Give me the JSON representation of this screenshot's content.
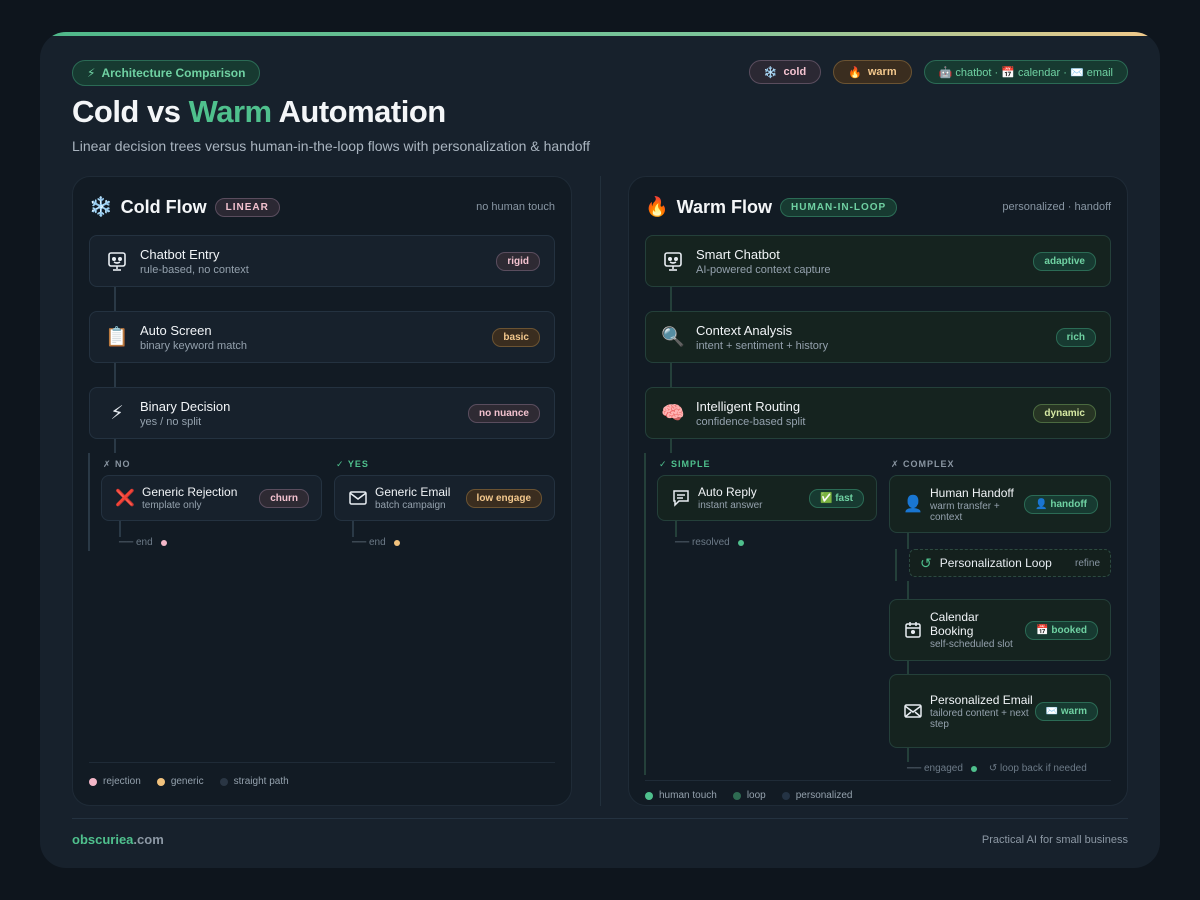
{
  "header": {
    "badge_icon": "⚡",
    "badge_label": "Architecture Comparison",
    "chips": {
      "cold_icon": "❄️",
      "cold": "cold",
      "warm_icon": "🔥",
      "warm": "warm",
      "tools": "🤖 chatbot · 📅 calendar · ✉️ email"
    },
    "title_pre": "Cold vs ",
    "title_accent": "Warm",
    "title_post": " Automation",
    "subtitle": "Linear decision trees versus human-in-the-loop flows with personalization & handoff"
  },
  "cold": {
    "emoji": "❄️",
    "title": "Cold Flow",
    "tag": "LINEAR",
    "note": "no human touch",
    "nodes": [
      {
        "title": "Chatbot Entry",
        "sub": "rule-based, no context",
        "badge": "rigid"
      },
      {
        "title": "Auto Screen",
        "sub": "binary keyword match",
        "badge": "basic",
        "icon": "📋"
      },
      {
        "title": "Binary Decision",
        "sub": "yes / no split",
        "badge": "no nuance",
        "icon": "⚡"
      }
    ],
    "branch_no": "✗ NO",
    "branch_yes": "✓ YES",
    "no_node": {
      "title": "Generic Rejection",
      "sub": "template only",
      "badge": "churn",
      "icon": "❌"
    },
    "yes_node": {
      "title": "Generic Email",
      "sub": "batch campaign",
      "badge": "low engage"
    },
    "end_no": "── end",
    "end_yes": "── end",
    "legend": [
      "rejection",
      "generic",
      "straight path"
    ]
  },
  "warm": {
    "emoji": "🔥",
    "title": "Warm Flow",
    "tag": "HUMAN-IN-LOOP",
    "note": "personalized · handoff",
    "nodes": [
      {
        "title": "Smart Chatbot",
        "sub": "AI-powered context capture",
        "badge": "adaptive"
      },
      {
        "title": "Context Analysis",
        "sub": "intent + sentiment + history",
        "badge": "rich",
        "icon": "🔍"
      },
      {
        "title": "Intelligent Routing",
        "sub": "confidence-based split",
        "badge": "dynamic",
        "icon": "🧠"
      }
    ],
    "branch_simple": "✓ SIMPLE",
    "branch_complex": "✗ COMPLEX",
    "simple_node": {
      "title": "Auto Reply",
      "sub": "instant answer",
      "badge": "✅ fast"
    },
    "simple_end": "── resolved",
    "handoff": {
      "title": "Human Handoff",
      "sub": "warm transfer + context",
      "badge": "👤 handoff",
      "icon": "👤"
    },
    "loop": {
      "title": "Personalization Loop",
      "tag": "refine",
      "icon": "↺"
    },
    "calendar": {
      "title": "Calendar Booking",
      "sub": "self-scheduled slot",
      "badge": "📅 booked"
    },
    "email": {
      "title": "Personalized Email",
      "sub": "tailored content + next step",
      "badge": "✉️ warm"
    },
    "engaged": "── engaged",
    "loop_back": "↺ loop back if needed",
    "legend": [
      "human touch",
      "loop",
      "personalized"
    ]
  },
  "footer": {
    "brand": "obscuriea",
    "brand_tld": ".com",
    "tagline": "Practical AI for small business"
  }
}
